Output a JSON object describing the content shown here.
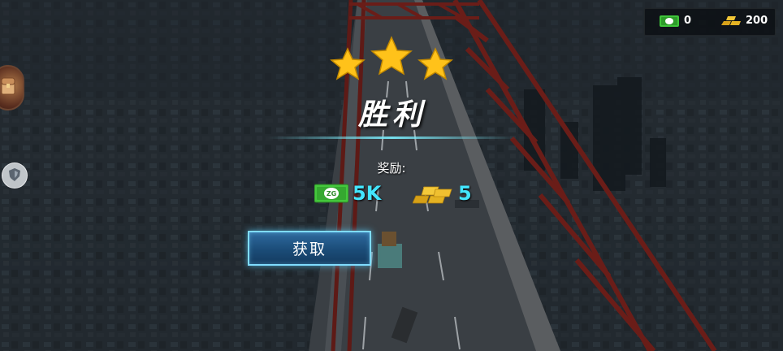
{
  "currency": {
    "cash_amount": "0",
    "gold_amount": "200",
    "cash_icon": "cash-icon",
    "gold_icon": "gold-bars-icon"
  },
  "result": {
    "stars_earned": 3,
    "stars_total": 3,
    "title": "胜利"
  },
  "rewards": {
    "label": "奖励:",
    "cash_amount": "5K",
    "gold_amount": "5",
    "cash_icon_text": "ZG"
  },
  "claim_button": {
    "label": "获取"
  },
  "colors": {
    "star": "#ffc21a",
    "reward_value": "#43e6ff",
    "button_border": "#7fdcff",
    "cash": "#3fc43a"
  }
}
